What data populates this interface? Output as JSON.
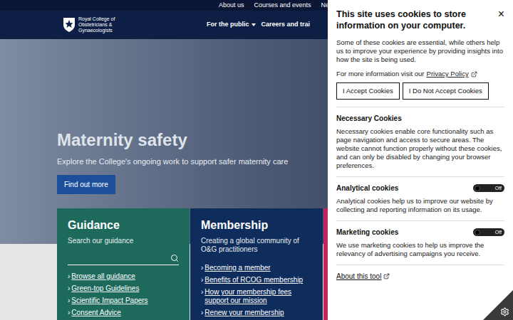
{
  "top_links": [
    "About us",
    "Courses and events",
    "News"
  ],
  "logo": {
    "lines": [
      "Royal College of",
      "Obstetricians &",
      "Gynaecologists"
    ]
  },
  "nav": [
    {
      "label": "For the public",
      "dropdown": true
    },
    {
      "label": "Careers and trai",
      "dropdown": false
    }
  ],
  "hero": {
    "title": "Maternity safety",
    "subtitle": "Explore the College's ongoing work to support safer maternity care",
    "button": "Find out more"
  },
  "link_marker": "›",
  "cards": [
    {
      "title": "Guidance",
      "subtitle": "Search our guidance",
      "search": true,
      "color": "#1d6a5c",
      "links": [
        "Browse all guidance",
        "Green-top Guidelines",
        "Scientific Impact Papers",
        "Consent Advice"
      ]
    },
    {
      "title": "Membership",
      "subtitle": "Creating a global community of O&G practitioners",
      "search": false,
      "color": "#0f2d5c",
      "links": [
        "Becoming a member",
        "Benefits of RCOG membership",
        "How your membership fees support our mission",
        "Renew your membership"
      ]
    }
  ],
  "cookie_panel": {
    "title": "This site uses cookies to store information on your computer.",
    "close": "×",
    "intro": "Some of these cookies are essential, while others help us to improve your experience by providing insights into how the site is being used.",
    "privacy_prefix": "For more information visit our",
    "privacy_link": "Privacy Policy",
    "buttons": [
      "I Accept Cookies",
      "I Do Not Accept Cookies"
    ],
    "sections": [
      {
        "kind": "info",
        "title": "Necessary Cookies",
        "text": "Necessary cookies enable core functionality such as page navigation and access to secure areas. The website cannot function properly without these cookies, and can only be disabled by changing your browser preferences."
      },
      {
        "kind": "toggle",
        "title": "Analytical cookies",
        "on": false,
        "toggle_label": "Off",
        "text": "Analytical cookies help us to improve our website by collecting and reporting information on its usage."
      },
      {
        "kind": "toggle",
        "title": "Marketing cookies",
        "on": false,
        "toggle_label": "Off",
        "text": "We use marketing cookies to help us improve the relevancy of advertising campaigns you receive."
      }
    ],
    "about_link": "About this tool"
  }
}
